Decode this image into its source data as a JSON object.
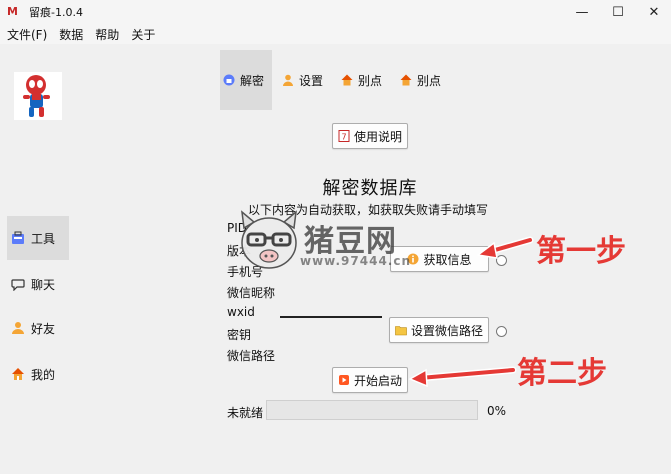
{
  "window": {
    "title": "留痕-1.0.4",
    "logo_glyph": "M",
    "controls": {
      "minimize": "—",
      "maximize": "☐",
      "close": "✕"
    }
  },
  "menu": [
    {
      "label": "文件(F)"
    },
    {
      "label": "数据"
    },
    {
      "label": "帮助"
    },
    {
      "label": "关于"
    }
  ],
  "sidebar": {
    "avatar_icon": "spiderman-avatar",
    "items": [
      {
        "label": "工具",
        "icon": "toolbox-icon",
        "active": true
      },
      {
        "label": "聊天",
        "icon": "chat-bubble-icon",
        "active": false
      },
      {
        "label": "好友",
        "icon": "person-icon",
        "active": false
      },
      {
        "label": "我的",
        "icon": "home-icon",
        "active": false
      }
    ]
  },
  "tabs": [
    {
      "label": "解密",
      "icon": "unlock-icon",
      "active": true
    },
    {
      "label": "设置",
      "icon": "person-icon",
      "active": false
    },
    {
      "label": "别点",
      "icon": "house-icon",
      "active": false
    },
    {
      "label": "别点",
      "icon": "house-icon",
      "active": false
    }
  ],
  "main": {
    "instructions_button": "使用说明",
    "heading": "解密数据库",
    "subheading": "以下内容为自动获取，如获取失败请手动填写",
    "fields": {
      "pid": "PID",
      "version": "版本",
      "phone": "手机号",
      "nickname": "微信昵称",
      "wxid": "wxid",
      "key": "密钥",
      "path": "微信路径"
    },
    "get_info_button": "获取信息",
    "set_path_button": "设置微信路径",
    "start_button": "开始启动",
    "status": "未就绪",
    "progress_percent": 0,
    "progress_label": "0%"
  },
  "watermark": {
    "text": "猪豆网",
    "url": "www.97444.cn"
  },
  "annotations": {
    "step1": "第一步",
    "step2": "第二步"
  },
  "colors": {
    "accent_red": "#e53935",
    "background": "#f0f0f0",
    "progress_fill": "#06b025"
  }
}
